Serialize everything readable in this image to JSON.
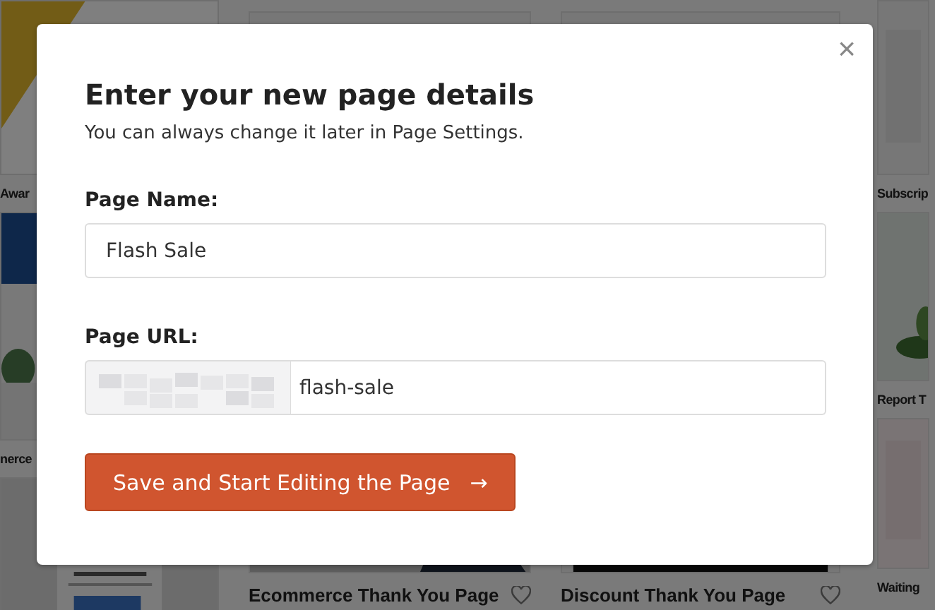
{
  "gallery": {
    "columns": [
      {
        "cards": [
          {
            "title": "Awar"
          },
          {
            "title": "nerce"
          }
        ]
      },
      {
        "cards": [
          {
            "title": "Ecommerce Thank You Page",
            "favorite": false
          }
        ]
      },
      {
        "cards": [
          {
            "title": "Discount Thank You Page",
            "favorite": false
          }
        ]
      },
      {
        "cards": [
          {
            "title": "Subscrip"
          },
          {
            "title": "Report T"
          },
          {
            "title": "Waiting"
          }
        ]
      }
    ]
  },
  "dialog": {
    "close": "×",
    "title": "Enter your new page details",
    "subtitle": "You can always change it later in Page Settings.",
    "fields": [
      {
        "kind": "text",
        "label": "Page Name:",
        "value": "Flash Sale"
      },
      {
        "kind": "url",
        "label": "Page URL:",
        "value": "flash-sale"
      }
    ],
    "button": {
      "label": "Save and Start Editing the Page",
      "arrow": "→"
    }
  }
}
